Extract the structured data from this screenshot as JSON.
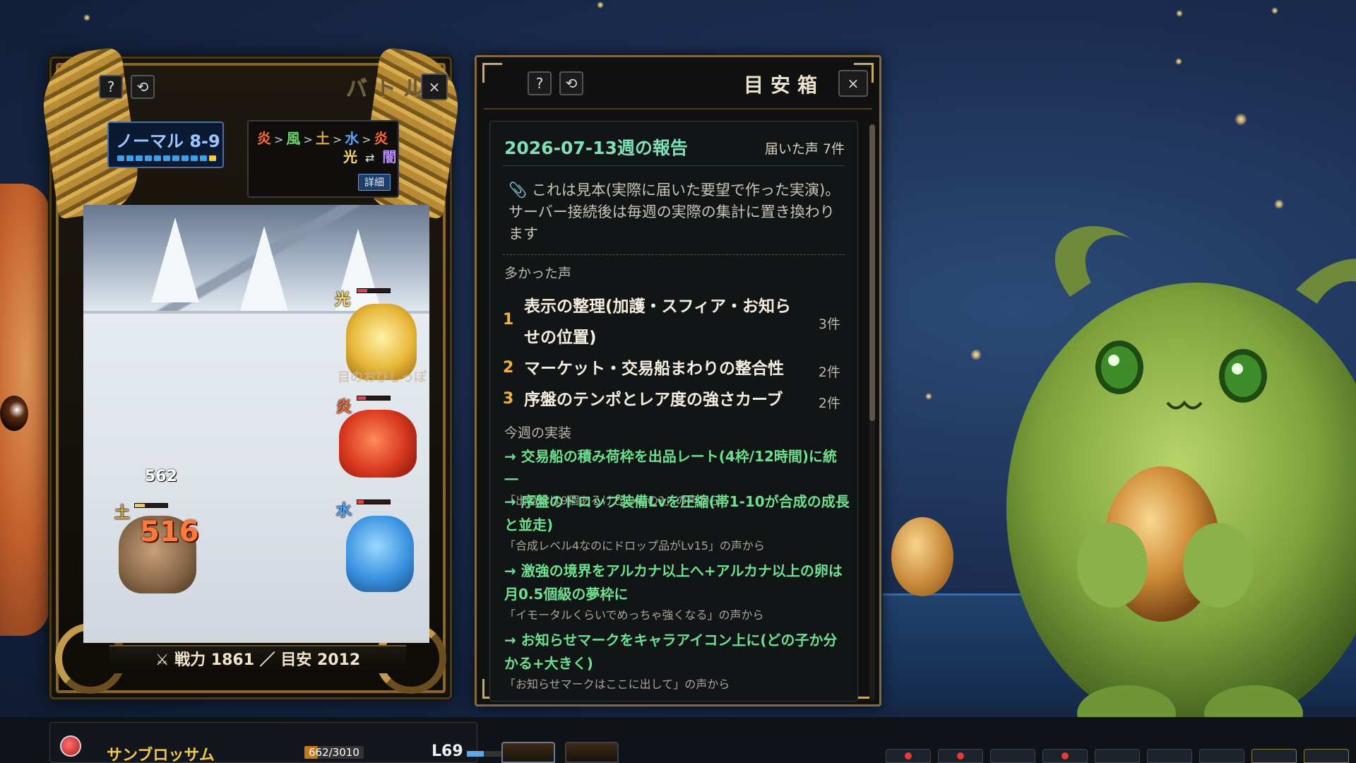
{
  "battle": {
    "title": "バトル",
    "help_label": "?",
    "refresh_label": "⟲",
    "close_label": "×",
    "stage": "ノーマル 8-9",
    "elements_line1": [
      "炎",
      "風",
      "土",
      "水",
      "炎"
    ],
    "elements_sep": ">",
    "elements_line2": [
      "光",
      "⇄",
      "闇"
    ],
    "detail_label": "詳細",
    "units": [
      {
        "element": "光",
        "hp": 0.3
      },
      {
        "element": "炎",
        "hp": 0.25
      },
      {
        "element": "水",
        "hp": 0.2
      },
      {
        "element": "土",
        "hp": 0.3
      }
    ],
    "sprite_caption": "目のおひしっぽ",
    "damage_small": "562",
    "damage_big": "516",
    "power": "⚔ 戦力 1861 ／ 目安 2012"
  },
  "feedback": {
    "title": "目安箱",
    "help_label": "?",
    "refresh_label": "⟲",
    "close_label": "×",
    "week_title": "2026-07-13週の報告",
    "votes": "届いた声 7件",
    "notice": "📎 これは見本(実際に届いた要望で作った実演)。サーバー接続後は毎週の実際の集計に置き換わります",
    "top_heading": "多かった声",
    "top_items": [
      {
        "rank": "1",
        "text": "表示の整理(加護・スフィア・お知らせの位置)",
        "count": "3件"
      },
      {
        "rank": "2",
        "text": "マーケット・交易船まわりの整合性",
        "count": "2件"
      },
      {
        "rank": "3",
        "text": "序盤のテンポとレア度の強さカーブ",
        "count": "2件"
      }
    ],
    "impl_heading": "今週の実装",
    "implementations": [
      {
        "text": "→ 交易船の積み荷枠を出品レート(4枠/12時間)に統一",
        "note": "「出品枠は9個あるけどいいの?」の声から"
      },
      {
        "text": "→ 序盤のドロップ装備Lvを圧縮(帯1-10が合成の成長と並走)",
        "note": "「合成レベル4なのにドロップ品がLv15」の声から"
      },
      {
        "text": "→ 激強の境界をアルカナ以上へ+アルカナ以上の卵は月0.5個級の夢枠に",
        "note": "「イモータルくらいでめっちゃ強くなる」の声から"
      },
      {
        "text": "→ お知らせマークをキャラアイコン上に(どの子か分かる+大きく)",
        "note": "「お知らせマークはここに出して」の声から"
      }
    ]
  },
  "bottom": {
    "char_name": "サンブロッサム",
    "char_hp": "662/3010",
    "char_hp_fraction": 0.22,
    "char_level": "L69",
    "char_xp_fraction": 0.4
  }
}
